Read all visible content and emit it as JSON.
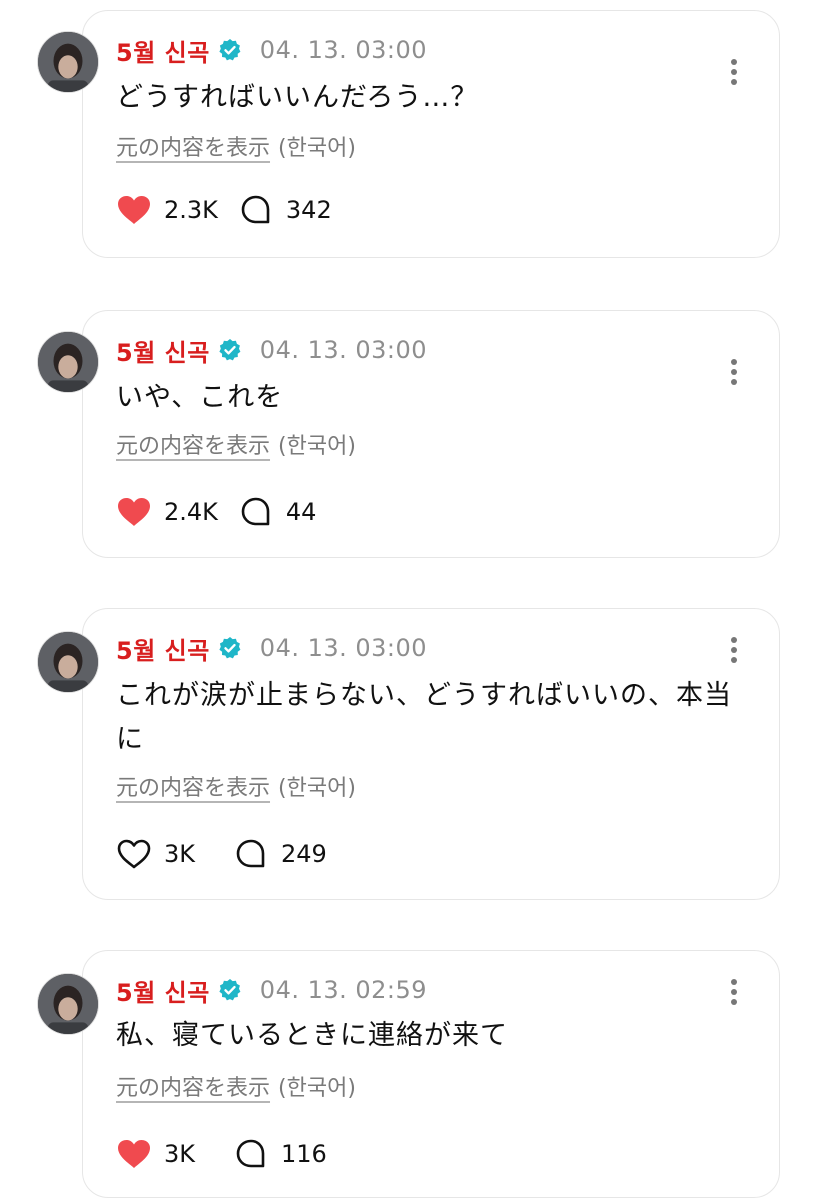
{
  "posts": [
    {
      "author": "5월 신곡",
      "time": "04. 13. 03:00",
      "text": "どうすればいいんだろう…？",
      "translate_label": "元の内容を表示",
      "translate_lang": "(한국어)",
      "likes": "2.3K",
      "liked": true,
      "replies": "342"
    },
    {
      "author": "5월 신곡",
      "time": "04. 13. 03:00",
      "text": "いや、これを",
      "translate_label": "元の内容を表示",
      "translate_lang": "(한국어)",
      "likes": "2.4K",
      "liked": true,
      "replies": "44"
    },
    {
      "author": "5월 신곡",
      "time": "04. 13. 03:00",
      "text": "これが涙が止まらない、どうすればいいの、本当に",
      "translate_label": "元の内容を表示",
      "translate_lang": "(한국어)",
      "likes": "3K",
      "liked": false,
      "replies": "249"
    },
    {
      "author": "5월 신곡",
      "time": "04. 13. 02:59",
      "text": "私、寝ているときに連絡が来て",
      "translate_label": "元の内容を表示",
      "translate_lang": "(한국어)",
      "likes": "3K",
      "liked": true,
      "replies": "116"
    }
  ],
  "colors": {
    "name": "#d81e1e",
    "verified": "#1fb6c8",
    "like_filled": "#f04a4f",
    "muted": "#8e8e8e"
  },
  "icons": {
    "verified": "verified-badge-icon",
    "more": "more-vertical-icon",
    "like": "heart-icon",
    "reply": "speech-bubble-icon"
  }
}
